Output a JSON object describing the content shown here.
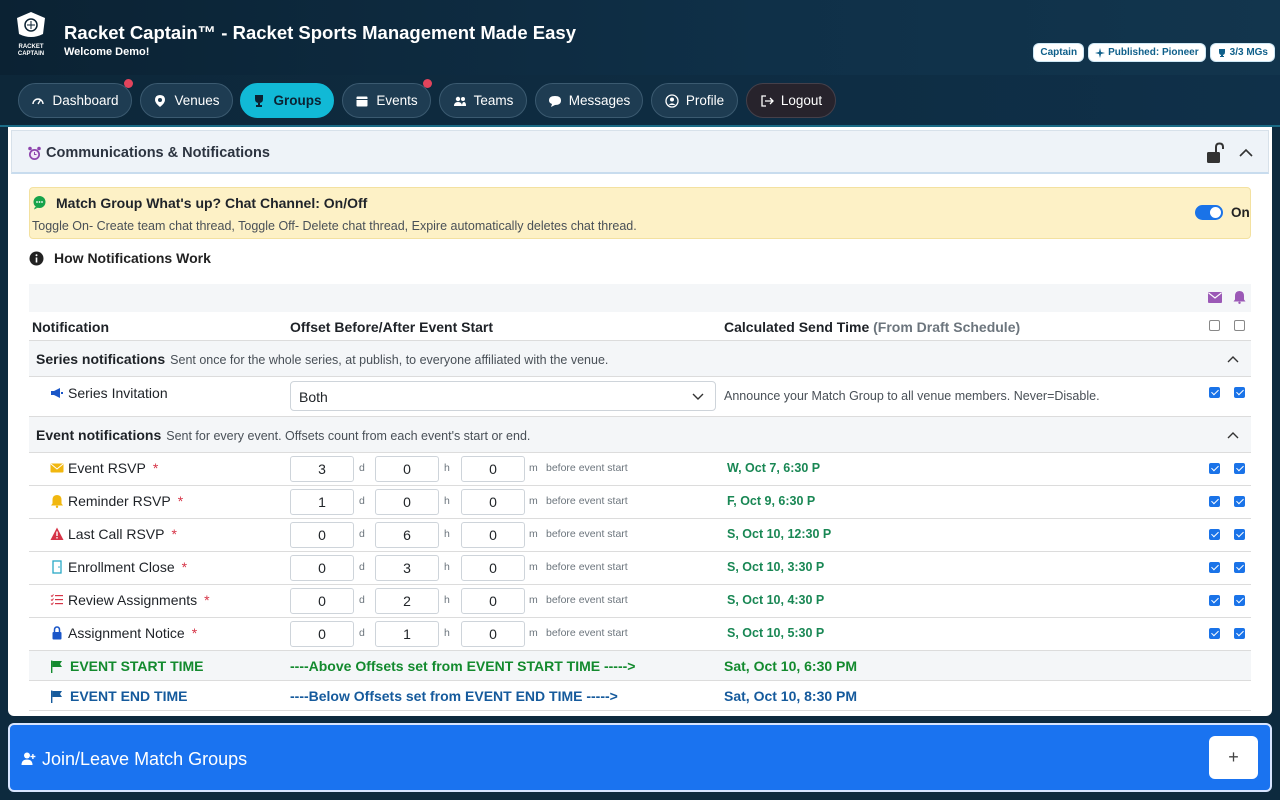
{
  "header": {
    "title": "Racket Captain™ - Racket Sports Management Made Easy",
    "welcome": "Welcome Demo!",
    "logo_text": "RACKET CAPTAIN",
    "badges": [
      "Captain",
      "Published: Pioneer",
      "3/3 MGs"
    ]
  },
  "nav": {
    "items": [
      {
        "label": "Dashboard",
        "icon": "gauge-icon",
        "dot": true
      },
      {
        "label": "Venues",
        "icon": "map-pin-icon",
        "dot": false
      },
      {
        "label": "Groups",
        "icon": "trophy-icon",
        "dot": false,
        "active": true
      },
      {
        "label": "Events",
        "icon": "calendar-icon",
        "dot": true
      },
      {
        "label": "Teams",
        "icon": "people-icon",
        "dot": false
      },
      {
        "label": "Messages",
        "icon": "chat-icon",
        "dot": false
      },
      {
        "label": "Profile",
        "icon": "user-circle-icon",
        "dot": false
      },
      {
        "label": "Logout",
        "icon": "logout-icon",
        "dot": false
      }
    ]
  },
  "section": {
    "title": "Communications & Notifications"
  },
  "chat": {
    "title": "Match Group What's up? Chat Channel: On/Off",
    "description": "Toggle On- Create team chat thread, Toggle Off- Delete chat thread, Expire automatically deletes chat thread.",
    "toggle_label": "On",
    "toggle_on": true
  },
  "info": {
    "label": "How Notifications Work"
  },
  "table": {
    "headers": {
      "notification": "Notification",
      "offset": "Offset Before/After Event Start",
      "calc": "Calculated Send Time",
      "calc_sub": "(From Draft Schedule)"
    },
    "series_group": {
      "title": "Series notifications",
      "desc": "Sent once for the whole series, at publish, to everyone affiliated with the venue."
    },
    "series_row": {
      "name": "Series Invitation",
      "select_value": "Both",
      "announce": "Announce your Match Group to all venue members. Never=Disable."
    },
    "event_group": {
      "title": "Event notifications",
      "desc": "Sent for every event. Offsets count from each event's start or end."
    },
    "units": {
      "d": "d",
      "h": "h",
      "m": "m"
    },
    "before_label": "before event start",
    "events": [
      {
        "name": "Event RSVP",
        "req": "*",
        "d": "3",
        "h": "0",
        "m": "0",
        "calc": "W, Oct 7, 6:30 P"
      },
      {
        "name": "Reminder RSVP",
        "req": "*",
        "d": "1",
        "h": "0",
        "m": "0",
        "calc": "F, Oct 9, 6:30 P"
      },
      {
        "name": "Last Call RSVP",
        "req": "*",
        "d": "0",
        "h": "6",
        "m": "0",
        "calc": "S, Oct 10, 12:30 P"
      },
      {
        "name": "Enrollment Close",
        "req": "*",
        "d": "0",
        "h": "3",
        "m": "0",
        "calc": "S, Oct 10, 3:30 P"
      },
      {
        "name": "Review Assignments",
        "req": "*",
        "d": "0",
        "h": "2",
        "m": "0",
        "calc": "S, Oct 10, 4:30 P"
      },
      {
        "name": "Assignment Notice",
        "req": "*",
        "d": "0",
        "h": "1",
        "m": "0",
        "calc": "S, Oct 10, 5:30 P"
      }
    ],
    "start_row": {
      "name": "EVENT START TIME",
      "middle": "----Above Offsets set from EVENT START TIME ----->",
      "time": "Sat, Oct 10, 6:30 PM"
    },
    "end_row": {
      "name": "EVENT END TIME",
      "middle": "----Below Offsets set from EVENT END TIME ----->",
      "time": "Sat, Oct 10, 8:30 PM"
    }
  },
  "join": {
    "title": "Join/Leave Match Groups",
    "button": "+"
  }
}
